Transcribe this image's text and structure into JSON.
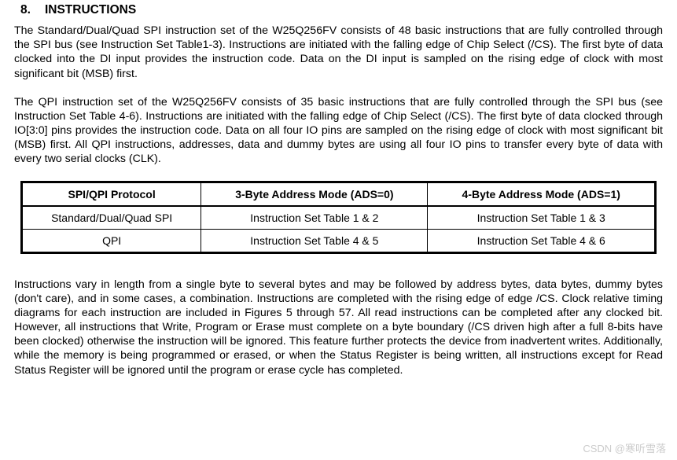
{
  "heading": {
    "number": "8.",
    "title": "INSTRUCTIONS"
  },
  "paragraphs": {
    "p1": "The Standard/Dual/Quad SPI instruction set of the W25Q256FV consists of 48 basic instructions that are fully controlled through the SPI bus (see Instruction Set Table1-3). Instructions are initiated with the falling edge of Chip Select (/CS). The first byte of data clocked into the DI input provides the instruction code. Data on the DI input is sampled on the rising edge of clock with most significant bit (MSB) first.",
    "p2": "The QPI instruction set of the W25Q256FV consists of 35 basic instructions that are fully controlled through the SPI bus (see Instruction Set Table 4-6). Instructions are initiated with the falling edge of Chip Select (/CS). The first byte of data clocked through IO[3:0] pins provides the instruction code. Data on all four IO pins are sampled on the rising edge of clock with most significant bit (MSB) first. All QPI instructions, addresses, data and dummy bytes are using all four IO pins to transfer every byte of data with every two serial clocks (CLK).",
    "p3": "Instructions vary in length from a single byte to several bytes and may be followed by address bytes, data bytes, dummy bytes (don't care), and in some cases, a combination. Instructions are completed with the rising edge of edge /CS. Clock relative timing diagrams for each instruction are included in Figures 5 through 57. All read instructions can be completed after any clocked bit. However, all instructions that Write, Program or Erase must complete on a byte boundary (/CS driven high after a full 8-bits have been clocked) otherwise the instruction will be ignored. This feature further protects the device from inadvertent writes. Additionally, while the memory is being programmed or erased, or when the Status Register is being written, all instructions except for Read Status Register will be ignored until the program or erase cycle has completed."
  },
  "table": {
    "headers": {
      "col1": "SPI/QPI Protocol",
      "col2": "3-Byte Address Mode (ADS=0)",
      "col3": "4-Byte Address Mode (ADS=1)"
    },
    "rows": [
      {
        "c1": "Standard/Dual/Quad SPI",
        "c2": "Instruction Set Table 1 & 2",
        "c3": "Instruction Set Table 1 & 3"
      },
      {
        "c1": "QPI",
        "c2": "Instruction Set Table 4 & 5",
        "c3": "Instruction Set Table 4 & 6"
      }
    ]
  },
  "watermark": "CSDN @寒听雪落"
}
